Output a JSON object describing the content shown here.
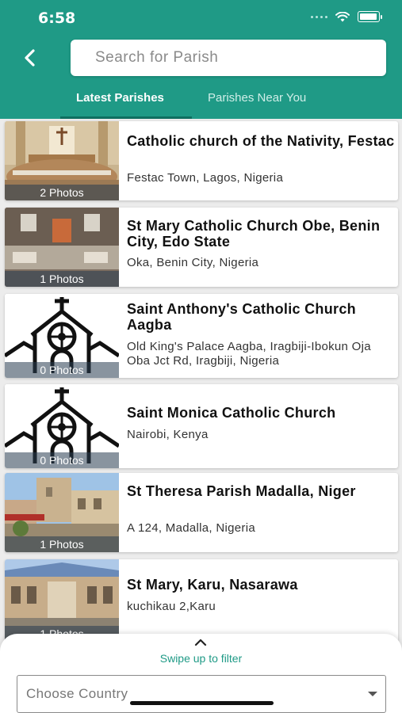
{
  "status": {
    "time": "6:58"
  },
  "header": {
    "search_placeholder": "Search for Parish",
    "tabs": [
      "Latest Parishes",
      "Parishes Near You"
    ],
    "back_icon": "chevron-left-icon"
  },
  "parishes": [
    {
      "title": "Catholic church of the Nativity, Festac",
      "address": "Festac Town, Lagos, Nigeria",
      "photos": "2 Photos"
    },
    {
      "title": "St Mary Catholic Church Obe, Benin City, Edo State",
      "address": "Oka, Benin City, Nigeria",
      "photos": "1 Photos"
    },
    {
      "title": "Saint Anthony's Catholic Church Aagba",
      "address": "Old King's Palace Aagba, Iragbiji-Ibokun Oja Oba Jct Rd, Iragbiji, Nigeria",
      "photos": "0 Photos"
    },
    {
      "title": "Saint Monica Catholic Church",
      "address": "Nairobi, Kenya",
      "photos": "0 Photos"
    },
    {
      "title": "St Theresa Parish Madalla, Niger",
      "address": "A 124, Madalla, Nigeria",
      "photos": "1 Photos"
    },
    {
      "title": "St Mary, Karu, Nasarawa",
      "address": "kuchikau 2,Karu",
      "photos": "1 Photos"
    }
  ],
  "filter": {
    "swipe_hint": "Swipe up to filter",
    "country_placeholder": "Choose Country"
  },
  "colors": {
    "primary": "#1f9a86",
    "tab_indicator": "#0f6f60"
  }
}
